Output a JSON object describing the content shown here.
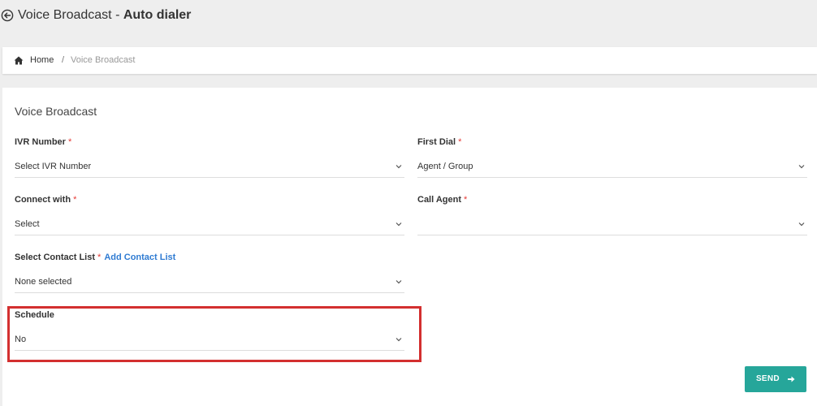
{
  "header": {
    "title_main": "Voice Broadcast - ",
    "title_bold": "Auto dialer"
  },
  "breadcrumb": {
    "home": "Home",
    "separator": "/",
    "current": "Voice Broadcast"
  },
  "panel": {
    "title": "Voice Broadcast",
    "fields": {
      "ivr_number": {
        "label": "IVR Number",
        "required": "*",
        "value": "Select IVR Number"
      },
      "first_dial": {
        "label": "First Dial",
        "required": "*",
        "value": "Agent / Group"
      },
      "connect_with": {
        "label": "Connect with",
        "required": "*",
        "value": "Select"
      },
      "call_agent": {
        "label": "Call Agent",
        "required": "*",
        "value": ""
      },
      "contact_list": {
        "label": "Select Contact List",
        "required": "*",
        "link": "Add Contact List",
        "value": "None selected"
      },
      "schedule": {
        "label": "Schedule",
        "value": "No"
      }
    },
    "send_button": "SEND"
  },
  "colors": {
    "accent": "#26a69a",
    "link": "#2f7bd2",
    "required": "#e53935",
    "highlight": "#d32f2f"
  }
}
